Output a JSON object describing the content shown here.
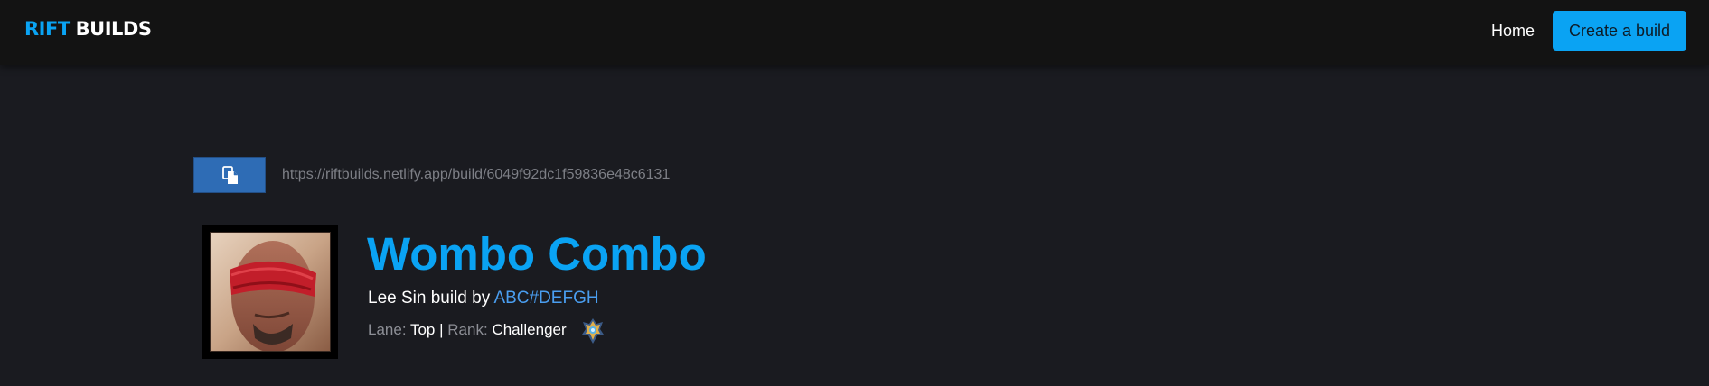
{
  "navbar": {
    "logo_part1": "RIFT",
    "logo_part2": "BUILDS",
    "home_label": "Home",
    "create_label": "Create a build",
    "accent_color": "#0aa3f3"
  },
  "share": {
    "copy_icon": "copy-icon",
    "url": "https://riftbuilds.netlify.app/build/6049f92dc1f59836e48c6131"
  },
  "build": {
    "champion_icon": "lee-sin-portrait",
    "title": "Wombo Combo",
    "champion_text": "Lee Sin build by",
    "author": "ABC#DEFGH",
    "lane_label": "Lane:",
    "lane_value": "Top",
    "separator": "|",
    "rank_label": "Rank:",
    "rank_value": "Challenger",
    "rank_icon": "challenger-rank-icon"
  }
}
